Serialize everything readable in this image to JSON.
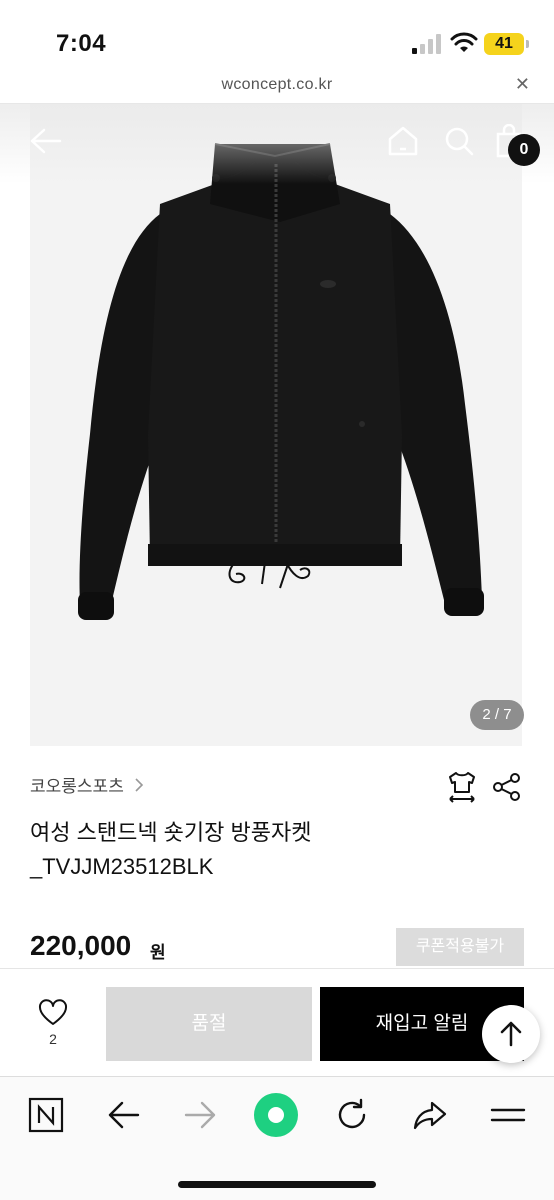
{
  "status_bar": {
    "time": "7:04",
    "battery": "41"
  },
  "url_bar": {
    "url": "wconcept.co.kr",
    "close_icon": "close-icon"
  },
  "product_image": {
    "page_indicator": "2 / 7",
    "cart_count": "0",
    "icons": [
      "back-arrow-icon",
      "home-icon",
      "search-icon",
      "cart-icon"
    ]
  },
  "product": {
    "brand": "코오롱스포츠",
    "title_line1": "여성 스탠드넥 숏기장 방풍자켓",
    "title_line2": "_TVJJM23512BLK",
    "price": "220,000",
    "price_unit": "원",
    "coupon_label": "쿠폰적용불가"
  },
  "purchase_bar": {
    "like_count": "2",
    "soldout_label": "품절",
    "restock_label": "재입고 알림"
  },
  "browser_toolbar": {
    "icons": [
      "naver-n-icon",
      "back-icon",
      "forward-icon",
      "green-dot-icon",
      "reload-icon",
      "share-icon",
      "menu-icon"
    ]
  },
  "colors": {
    "battery": "#f5d31c",
    "restock_button": "#000000",
    "soldout_button": "#d9d9d9",
    "coupon_button": "#dcdcdc",
    "green_dot": "#1ed081"
  }
}
